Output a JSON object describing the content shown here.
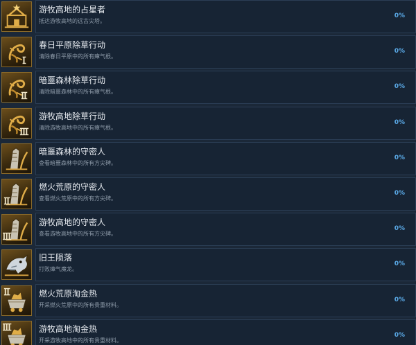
{
  "achievements": [
    {
      "title": "游牧高地的占星者",
      "description": "抵达游牧高地的远古尖塔。",
      "percent": "0%",
      "icon": "star-tower-icon"
    },
    {
      "title": "春日平原除草行动",
      "description": "清除春日平原中的所有瘴气根。",
      "percent": "0%",
      "icon": "root-tier-1-icon"
    },
    {
      "title": "暗噩森林除草行动",
      "description": "清除暗噩森林中的所有瘴气根。",
      "percent": "0%",
      "icon": "root-tier-2-icon"
    },
    {
      "title": "游牧高地除草行动",
      "description": "清除游牧高地中的所有瘴气根。",
      "percent": "0%",
      "icon": "root-tier-3-icon"
    },
    {
      "title": "暗噩森林的守密人",
      "description": "查看暗噩森林中的所有方尖碑。",
      "percent": "0%",
      "icon": "obelisk-tier-1-icon"
    },
    {
      "title": "燃火荒原的守密人",
      "description": "查看燃火荒原中的所有方尖碑。",
      "percent": "0%",
      "icon": "obelisk-tier-2-icon"
    },
    {
      "title": "游牧高地的守密人",
      "description": "查看游牧高地中的所有方尖碑。",
      "percent": "0%",
      "icon": "obelisk-tier-3-icon"
    },
    {
      "title": "旧王陨落",
      "description": "打败瘴气魔龙。",
      "percent": "0%",
      "icon": "dragon-head-icon"
    },
    {
      "title": "燃火荒原淘金热",
      "description": "开采燃火荒原中的所有贵重材料。",
      "percent": "0%",
      "icon": "mine-cart-tier-2-icon"
    },
    {
      "title": "游牧高地淘金热",
      "description": "开采游牧高地中的所有贵重材料。",
      "percent": "0%",
      "icon": "mine-cart-tier-3-icon"
    }
  ],
  "colors": {
    "background": "#1b2838",
    "panel": "#172434",
    "title": "#e6eaef",
    "description": "#8d9aa8",
    "percent": "#5aa9e6",
    "icon_gold": "#d9a441"
  }
}
